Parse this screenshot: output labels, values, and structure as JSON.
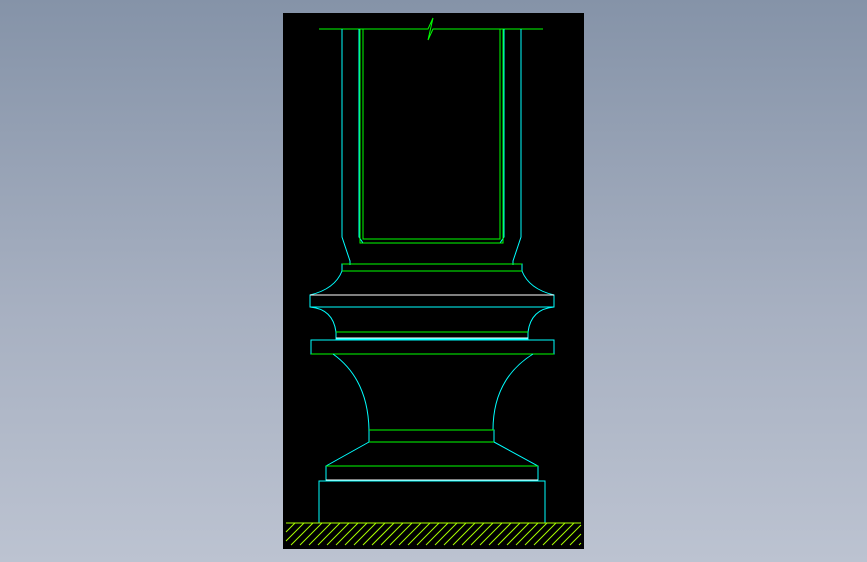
{
  "viewer": {
    "background": "#000000",
    "colors": {
      "outline": "#00ffff",
      "edge": "#00ff00",
      "highlight": "#ffffff",
      "ground": "#aaff00"
    }
  },
  "drawing": {
    "subject": "column-base-elevation",
    "parts": [
      "break-line",
      "shaft-outer",
      "shaft-inner",
      "neck-band",
      "upper-bulge",
      "upper-ring",
      "lower-collar",
      "middle-plate",
      "vase-body",
      "foot-band",
      "lower-bell",
      "plinth",
      "ground-hatch"
    ]
  }
}
